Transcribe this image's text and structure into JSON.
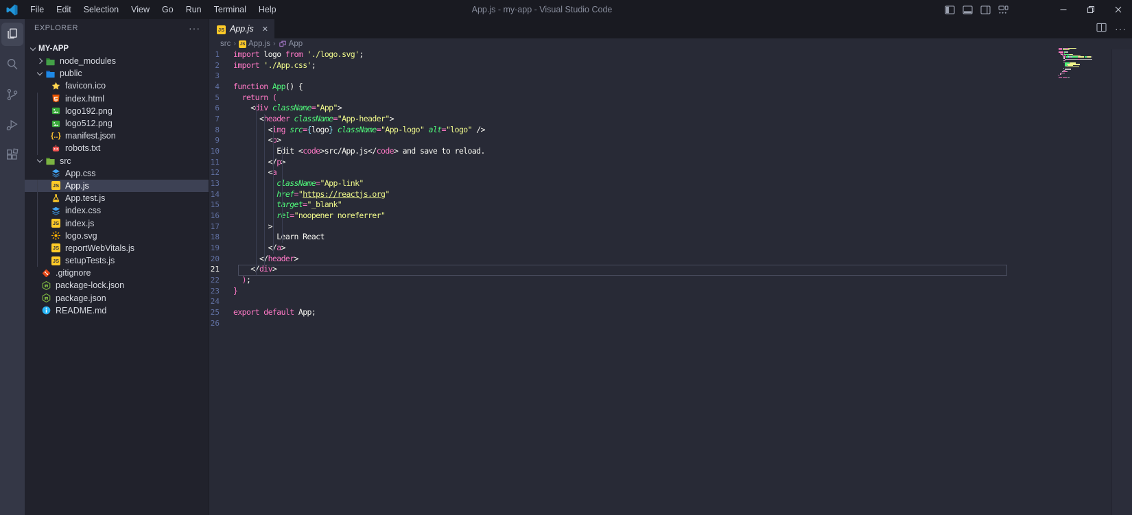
{
  "colors": {
    "bg_editor": "#282a36",
    "bg_sidebar": "#21222c",
    "bg_titlebar": "#191a21",
    "bg_activitybar": "#343746",
    "selection": "#44475a",
    "line_number": "#6272a4",
    "keyword_pink": "#ff79c6",
    "string_yellow": "#f1fa8c",
    "function_green": "#50fa7b",
    "bracket_cyan": "#8be9fd",
    "foreground": "#f8f8f2",
    "logo_blue": "#2196d9"
  },
  "title_bar": {
    "title": "App.js - my-app - Visual Studio Code",
    "menus": [
      "File",
      "Edit",
      "Selection",
      "View",
      "Go",
      "Run",
      "Terminal",
      "Help"
    ],
    "layout_icons": [
      "toggle-primary-sidebar",
      "toggle-panel",
      "toggle-secondary-sidebar",
      "customize-layout"
    ],
    "window_controls": [
      "minimize",
      "restore",
      "close"
    ]
  },
  "activity_bar": {
    "items": [
      {
        "id": "explorer",
        "active": true
      },
      {
        "id": "search",
        "active": false
      },
      {
        "id": "source-control",
        "active": false
      },
      {
        "id": "run-debug",
        "active": false
      },
      {
        "id": "extensions",
        "active": false
      }
    ]
  },
  "sidebar": {
    "header": "EXPLORER",
    "more_icon": "ellipsis",
    "root": "MY-APP",
    "items": [
      {
        "label": "node_modules",
        "icon": "folder-node-modules",
        "kind": "folder",
        "indent": 1,
        "expanded": false
      },
      {
        "label": "public",
        "icon": "folder-public",
        "kind": "folder",
        "indent": 1,
        "expanded": true
      },
      {
        "label": "favicon.ico",
        "icon": "favicon",
        "indent": 2
      },
      {
        "label": "index.html",
        "icon": "html",
        "indent": 2
      },
      {
        "label": "logo192.png",
        "icon": "image",
        "indent": 2
      },
      {
        "label": "logo512.png",
        "icon": "image",
        "indent": 2
      },
      {
        "label": "manifest.json",
        "icon": "json",
        "indent": 2
      },
      {
        "label": "robots.txt",
        "icon": "robots",
        "indent": 2
      },
      {
        "label": "src",
        "icon": "folder-src",
        "kind": "folder",
        "indent": 1,
        "expanded": true
      },
      {
        "label": "App.css",
        "icon": "css",
        "indent": 2
      },
      {
        "label": "App.js",
        "icon": "js",
        "indent": 2,
        "selected": true
      },
      {
        "label": "App.test.js",
        "icon": "test-js",
        "indent": 2
      },
      {
        "label": "index.css",
        "icon": "css",
        "indent": 2
      },
      {
        "label": "index.js",
        "icon": "js",
        "indent": 2
      },
      {
        "label": "logo.svg",
        "icon": "svg",
        "indent": 2
      },
      {
        "label": "reportWebVitals.js",
        "icon": "js",
        "indent": 2
      },
      {
        "label": "setupTests.js",
        "icon": "js",
        "indent": 2
      },
      {
        "label": ".gitignore",
        "icon": "git",
        "indent": 1
      },
      {
        "label": "package-lock.json",
        "icon": "npm",
        "indent": 1
      },
      {
        "label": "package.json",
        "icon": "npm",
        "indent": 1
      },
      {
        "label": "README.md",
        "icon": "readme",
        "indent": 1
      }
    ]
  },
  "editor": {
    "tabs": [
      {
        "label": "App.js",
        "icon": "js",
        "close_icon": "close",
        "active": true
      }
    ],
    "actions": [
      "split-editor",
      "more-actions"
    ],
    "breadcrumbs": [
      {
        "label": "src",
        "icon": null
      },
      {
        "label": "App.js",
        "icon": "js"
      },
      {
        "label": "App",
        "icon": "symbol-class"
      }
    ],
    "active_line": 21,
    "indent_guides": [
      {
        "col": 2,
        "from": 6,
        "to": 21
      },
      {
        "col": 4,
        "from": 7,
        "to": 20
      },
      {
        "col": 6,
        "from": 8,
        "to": 19
      },
      {
        "col": 8,
        "from": 10,
        "to": 18
      }
    ],
    "lines": [
      {
        "n": 1,
        "tokens": [
          [
            "import",
            "k"
          ],
          [
            " logo ",
            "w"
          ],
          [
            "from",
            "k"
          ],
          [
            " ",
            "w"
          ],
          [
            "'./logo.svg'",
            "s"
          ],
          [
            ";",
            "w"
          ]
        ]
      },
      {
        "n": 2,
        "tokens": [
          [
            "import",
            "k"
          ],
          [
            " ",
            "w"
          ],
          [
            "'./App.css'",
            "s"
          ],
          [
            ";",
            "w"
          ]
        ]
      },
      {
        "n": 3,
        "tokens": []
      },
      {
        "n": 4,
        "tokens": [
          [
            "function",
            "k"
          ],
          [
            " ",
            "w"
          ],
          [
            "App",
            "f"
          ],
          [
            "() {",
            "w"
          ]
        ]
      },
      {
        "n": 5,
        "tokens": [
          [
            "  ",
            "w"
          ],
          [
            "return",
            "k"
          ],
          [
            " ",
            "w"
          ],
          [
            "(",
            "k"
          ]
        ]
      },
      {
        "n": 6,
        "tokens": [
          [
            "    <",
            "w"
          ],
          [
            "div",
            "k"
          ],
          [
            " ",
            "w"
          ],
          [
            "className",
            "a"
          ],
          [
            "=",
            "k"
          ],
          [
            "\"App\"",
            "s"
          ],
          [
            ">",
            "w"
          ]
        ]
      },
      {
        "n": 7,
        "tokens": [
          [
            "      <",
            "w"
          ],
          [
            "header",
            "k"
          ],
          [
            " ",
            "w"
          ],
          [
            "className",
            "a"
          ],
          [
            "=",
            "k"
          ],
          [
            "\"App-header\"",
            "s"
          ],
          [
            ">",
            "w"
          ]
        ]
      },
      {
        "n": 8,
        "tokens": [
          [
            "        <",
            "w"
          ],
          [
            "img",
            "k"
          ],
          [
            " ",
            "w"
          ],
          [
            "src",
            "a"
          ],
          [
            "=",
            "k"
          ],
          [
            "{",
            "c"
          ],
          [
            "logo",
            "w"
          ],
          [
            "}",
            "c"
          ],
          [
            " ",
            "w"
          ],
          [
            "className",
            "a"
          ],
          [
            "=",
            "k"
          ],
          [
            "\"App-logo\"",
            "s"
          ],
          [
            " ",
            "w"
          ],
          [
            "alt",
            "a"
          ],
          [
            "=",
            "k"
          ],
          [
            "\"logo\"",
            "s"
          ],
          [
            " />",
            "w"
          ]
        ]
      },
      {
        "n": 9,
        "tokens": [
          [
            "        <",
            "w"
          ],
          [
            "p",
            "k"
          ],
          [
            ">",
            "w"
          ]
        ]
      },
      {
        "n": 10,
        "tokens": [
          [
            "          Edit <",
            "w"
          ],
          [
            "code",
            "k"
          ],
          [
            ">src/App.js</",
            "w"
          ],
          [
            "code",
            "k"
          ],
          [
            "> and save to reload.",
            "w"
          ]
        ]
      },
      {
        "n": 11,
        "tokens": [
          [
            "        </",
            "w"
          ],
          [
            "p",
            "k"
          ],
          [
            ">",
            "w"
          ]
        ]
      },
      {
        "n": 12,
        "tokens": [
          [
            "        <",
            "w"
          ],
          [
            "a",
            "k"
          ]
        ]
      },
      {
        "n": 13,
        "tokens": [
          [
            "          ",
            "w"
          ],
          [
            "className",
            "a"
          ],
          [
            "=",
            "k"
          ],
          [
            "\"App-link\"",
            "s"
          ]
        ]
      },
      {
        "n": 14,
        "tokens": [
          [
            "          ",
            "w"
          ],
          [
            "href",
            "a"
          ],
          [
            "=",
            "k"
          ],
          [
            "\"",
            "s"
          ],
          [
            "https://reactjs.org",
            "u"
          ],
          [
            "\"",
            "s"
          ]
        ]
      },
      {
        "n": 15,
        "tokens": [
          [
            "          ",
            "w"
          ],
          [
            "target",
            "a"
          ],
          [
            "=",
            "k"
          ],
          [
            "\"_blank\"",
            "s"
          ]
        ]
      },
      {
        "n": 16,
        "tokens": [
          [
            "          ",
            "w"
          ],
          [
            "rel",
            "a"
          ],
          [
            "=",
            "k"
          ],
          [
            "\"noopener noreferrer\"",
            "s"
          ]
        ]
      },
      {
        "n": 17,
        "tokens": [
          [
            "        >",
            "w"
          ]
        ]
      },
      {
        "n": 18,
        "tokens": [
          [
            "          Learn React",
            "w"
          ]
        ]
      },
      {
        "n": 19,
        "tokens": [
          [
            "        </",
            "w"
          ],
          [
            "a",
            "k"
          ],
          [
            ">",
            "w"
          ]
        ]
      },
      {
        "n": 20,
        "tokens": [
          [
            "      </",
            "w"
          ],
          [
            "header",
            "k"
          ],
          [
            ">",
            "w"
          ]
        ]
      },
      {
        "n": 21,
        "tokens": [
          [
            "    </",
            "w"
          ],
          [
            "div",
            "k"
          ],
          [
            ">",
            "w"
          ]
        ]
      },
      {
        "n": 22,
        "tokens": [
          [
            "  ",
            "w"
          ],
          [
            ")",
            "k"
          ],
          [
            ";",
            "w"
          ]
        ]
      },
      {
        "n": 23,
        "tokens": [
          [
            "}",
            "k"
          ]
        ]
      },
      {
        "n": 24,
        "tokens": []
      },
      {
        "n": 25,
        "tokens": [
          [
            "export",
            "k"
          ],
          [
            " ",
            "w"
          ],
          [
            "default",
            "k"
          ],
          [
            " App;",
            "w"
          ]
        ]
      },
      {
        "n": 26,
        "tokens": []
      }
    ]
  }
}
